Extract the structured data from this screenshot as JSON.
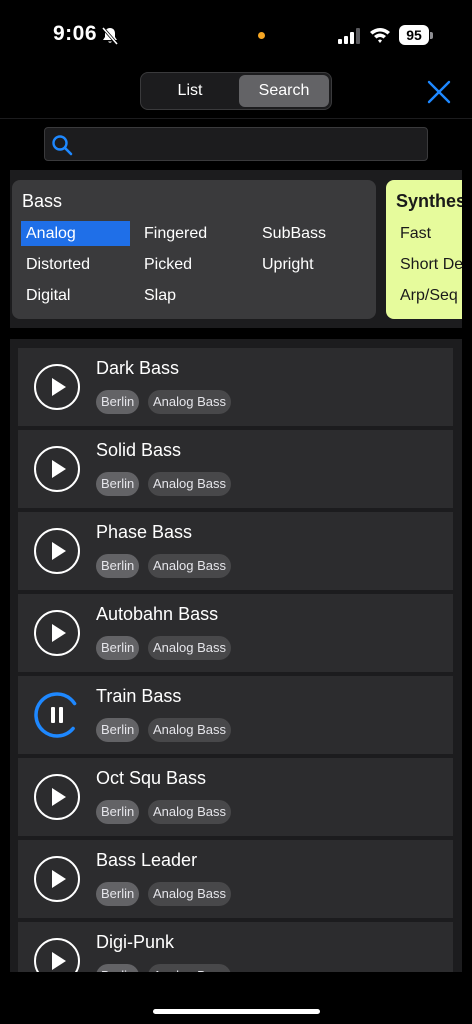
{
  "status_bar": {
    "time": "9:06",
    "battery": "95"
  },
  "header": {
    "tabs": [
      {
        "label": "List",
        "selected": false
      },
      {
        "label": "Search",
        "selected": true
      }
    ],
    "close_icon": "close-icon"
  },
  "search": {
    "value": "",
    "placeholder": ""
  },
  "categories": [
    {
      "title": "Bass",
      "options": [
        "Analog",
        "Distorted",
        "Digital",
        "Fingered",
        "Picked",
        "Slap",
        "SubBass",
        "Upright"
      ],
      "selected": "Analog"
    },
    {
      "title": "Synthes",
      "options": [
        "Fast",
        "Short De",
        "Arp/Seq"
      ]
    }
  ],
  "items": [
    {
      "title": "Dark Bass",
      "tags": [
        "Berlin",
        "Analog Bass"
      ],
      "state": "play"
    },
    {
      "title": "Solid Bass",
      "tags": [
        "Berlin",
        "Analog Bass"
      ],
      "state": "play"
    },
    {
      "title": "Phase Bass",
      "tags": [
        "Berlin",
        "Analog Bass"
      ],
      "state": "play"
    },
    {
      "title": "Autobahn Bass",
      "tags": [
        "Berlin",
        "Analog Bass"
      ],
      "state": "play"
    },
    {
      "title": "Train Bass",
      "tags": [
        "Berlin",
        "Analog Bass"
      ],
      "state": "playing"
    },
    {
      "title": "Oct Squ Bass",
      "tags": [
        "Berlin",
        "Analog Bass"
      ],
      "state": "play"
    },
    {
      "title": "Bass Leader",
      "tags": [
        "Berlin",
        "Analog Bass"
      ],
      "state": "play"
    },
    {
      "title": "Digi-Punk",
      "tags": [
        "Berlin",
        "Analog Bass"
      ],
      "state": "play"
    }
  ],
  "colors": {
    "accent": "#1f6fe8",
    "synth_card": "#e6fb9c",
    "progress": "#1e88ff"
  }
}
